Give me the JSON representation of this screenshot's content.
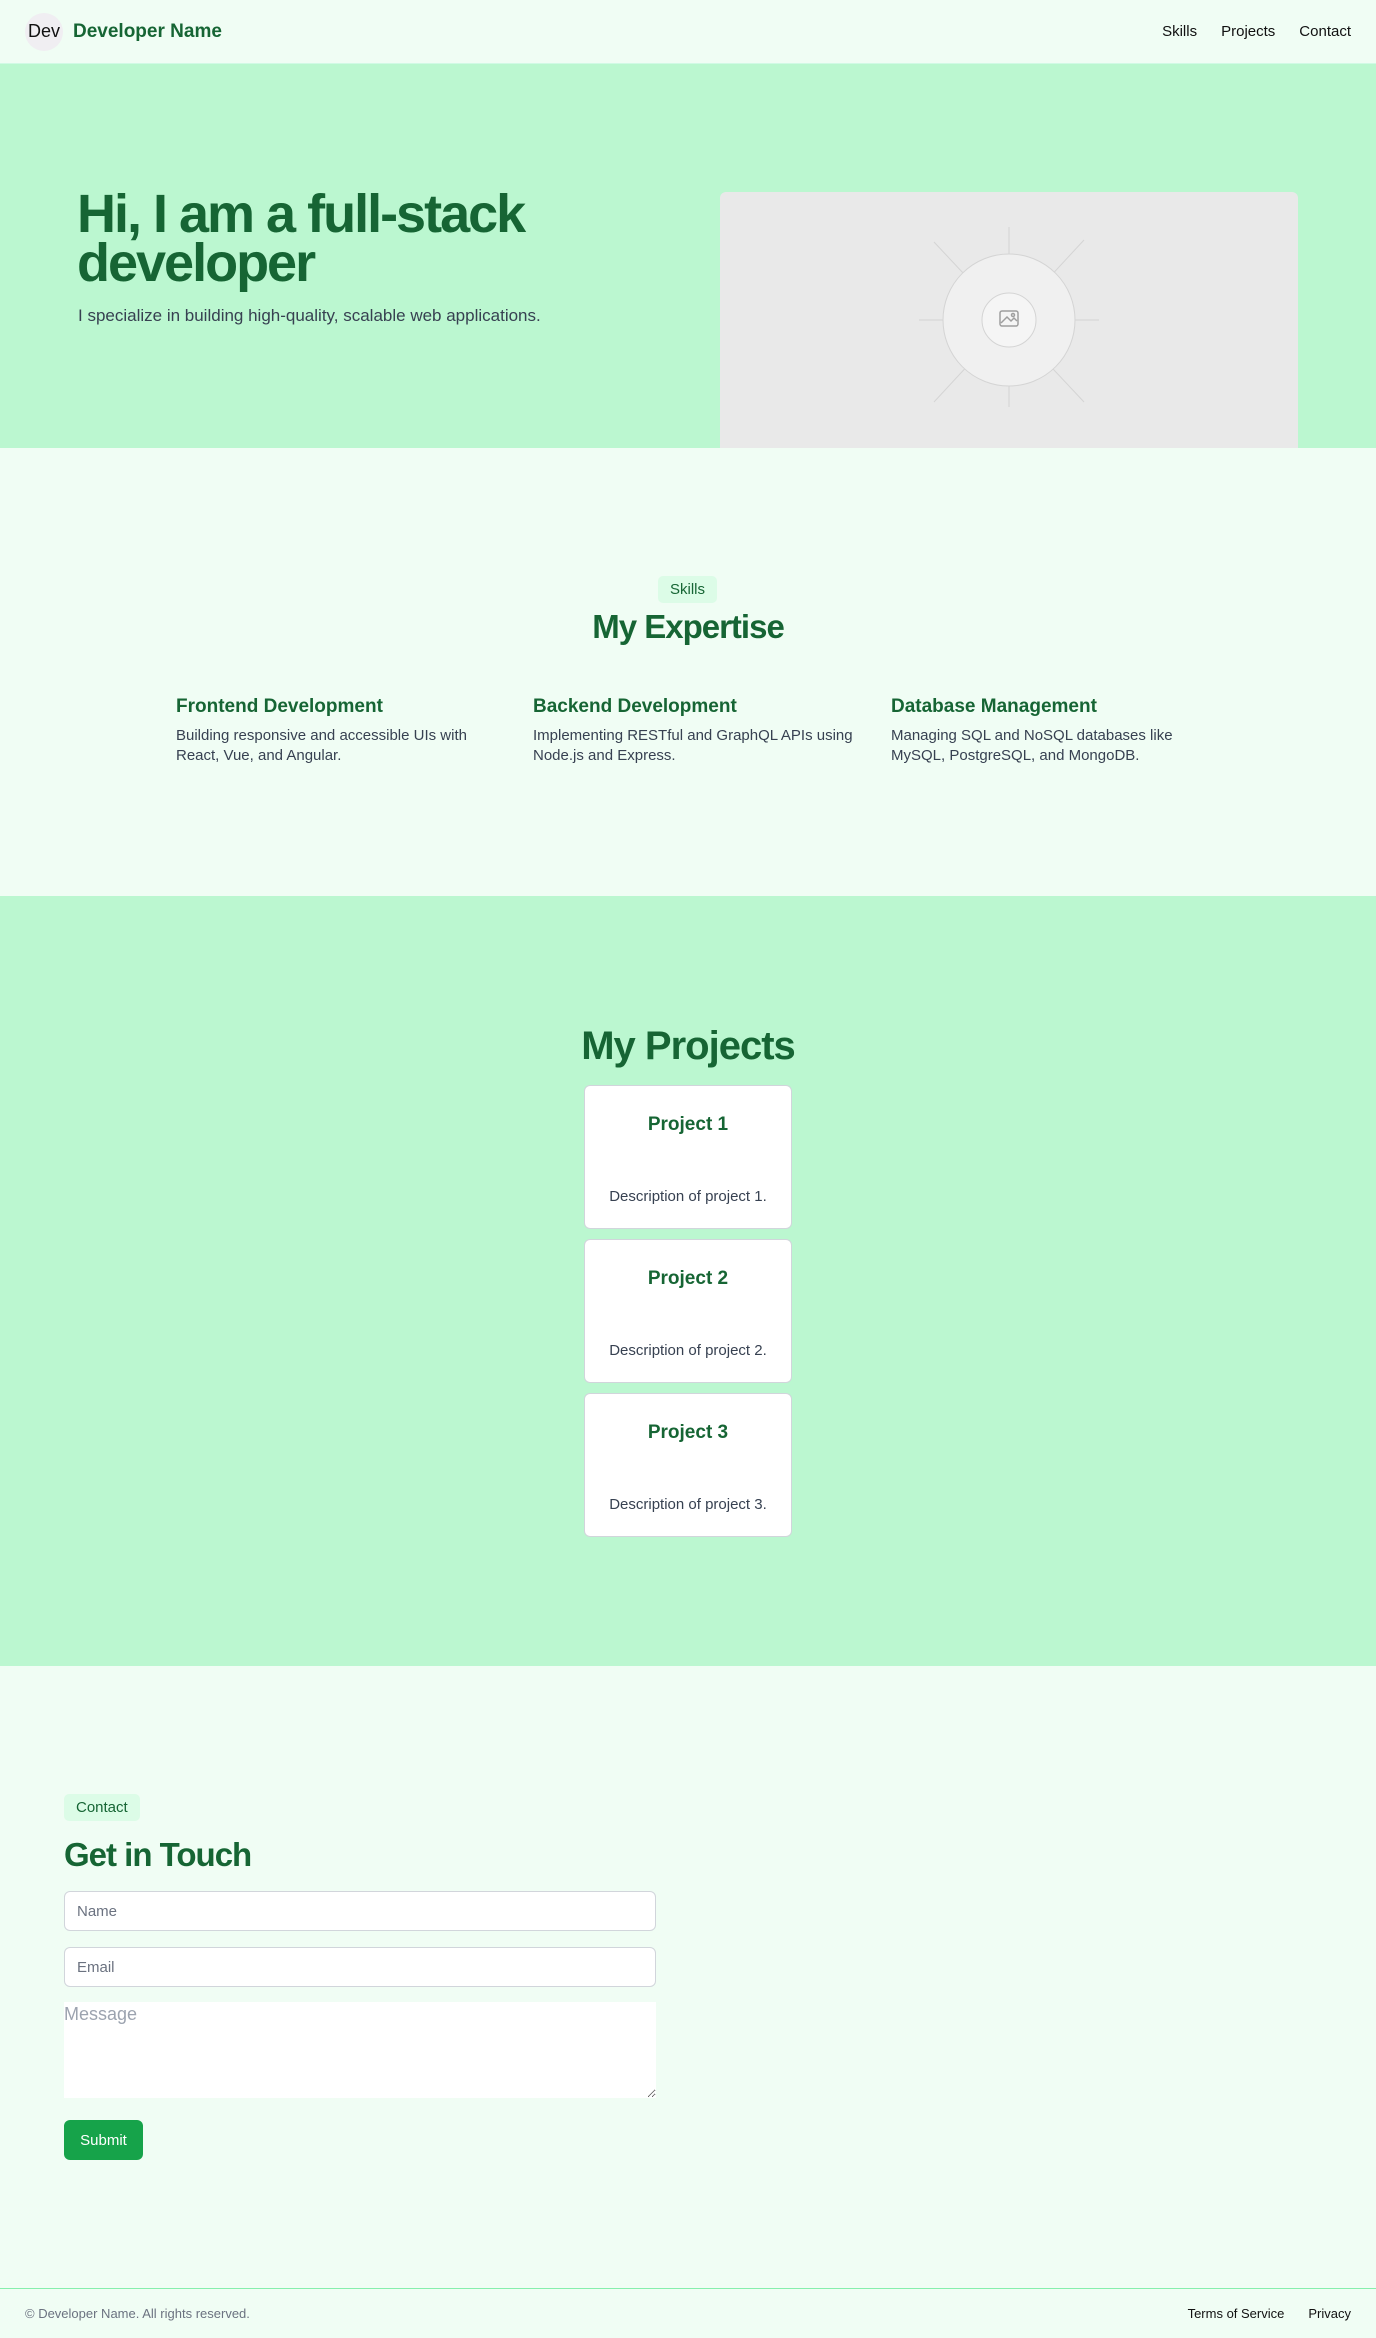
{
  "header": {
    "avatar_text": "Dev",
    "brand_name": "Developer Name",
    "nav": [
      "Skills",
      "Projects",
      "Contact"
    ]
  },
  "hero": {
    "title": "Hi, I am a full-stack developer",
    "subtitle": "I specialize in building high-quality, scalable web applications.",
    "image_icon": "image-placeholder-icon"
  },
  "skills": {
    "badge": "Skills",
    "title": "My Expertise",
    "items": [
      {
        "title": "Frontend Development",
        "description": "Building responsive and accessible UIs with React, Vue, and Angular."
      },
      {
        "title": "Backend Development",
        "description": "Implementing RESTful and GraphQL APIs using Node.js and Express."
      },
      {
        "title": "Database Management",
        "description": "Managing SQL and NoSQL databases like MySQL, PostgreSQL, and MongoDB."
      }
    ]
  },
  "projects": {
    "title": "My Projects",
    "items": [
      {
        "title": "Project 1",
        "description": "Description of project 1."
      },
      {
        "title": "Project 2",
        "description": "Description of project 2."
      },
      {
        "title": "Project 3",
        "description": "Description of project 3."
      }
    ]
  },
  "contact": {
    "badge": "Contact",
    "title": "Get in Touch",
    "name_placeholder": "Name",
    "email_placeholder": "Email",
    "message_placeholder": "Message",
    "submit_label": "Submit"
  },
  "footer": {
    "copyright": "© Developer Name. All rights reserved.",
    "links": [
      "Terms of Service",
      "Privacy"
    ]
  },
  "colors": {
    "primary": "#166534",
    "accent": "#16a34a",
    "hero_bg": "#bbf7d0",
    "page_bg": "#f0fdf4"
  }
}
